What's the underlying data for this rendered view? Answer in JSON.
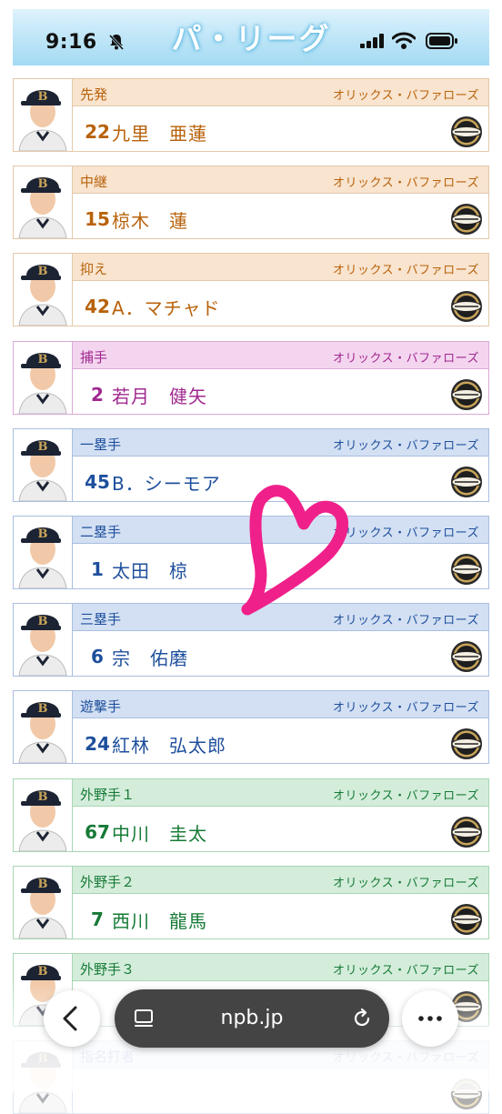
{
  "status_bar": {
    "time": "9:16"
  },
  "header": {
    "title": "パ・リーグ"
  },
  "players": [
    {
      "position": "先発",
      "team": "オリックス・バファローズ",
      "number": "22",
      "name": "九里　亜蓮",
      "theme": "orange"
    },
    {
      "position": "中継",
      "team": "オリックス・バファローズ",
      "number": "15",
      "name": "椋木　蓮",
      "theme": "orange"
    },
    {
      "position": "抑え",
      "team": "オリックス・バファローズ",
      "number": "42",
      "name": "A．マチャド",
      "theme": "orange"
    },
    {
      "position": "捕手",
      "team": "オリックス・バファローズ",
      "number": "2",
      "name": "若月　健矢",
      "theme": "pink"
    },
    {
      "position": "一塁手",
      "team": "オリックス・バファローズ",
      "number": "45",
      "name": "B．シーモア",
      "theme": "blue"
    },
    {
      "position": "二塁手",
      "team": "オリックス・バファローズ",
      "number": "1",
      "name": "太田　椋",
      "theme": "blue"
    },
    {
      "position": "三塁手",
      "team": "オリックス・バファローズ",
      "number": "6",
      "name": "宗　佑磨",
      "theme": "blue"
    },
    {
      "position": "遊撃手",
      "team": "オリックス・バファローズ",
      "number": "24",
      "name": "紅林　弘太郎",
      "theme": "blue"
    },
    {
      "position": "外野手１",
      "team": "オリックス・バファローズ",
      "number": "67",
      "name": "中川　圭太",
      "theme": "green"
    },
    {
      "position": "外野手２",
      "team": "オリックス・バファローズ",
      "number": "7",
      "name": "西川　龍馬",
      "theme": "green"
    },
    {
      "position": "外野手３",
      "team": "オリックス・バファローズ",
      "number": "",
      "name": "",
      "theme": "green"
    },
    {
      "position": "指名打者",
      "team": "オリックス・バファローズ",
      "number": "",
      "name": "",
      "theme": "blue"
    }
  ],
  "browser": {
    "url": "npb.jp"
  },
  "icons": {
    "back": "chevron-left-icon",
    "tabs": "tabs-icon",
    "reload": "reload-icon",
    "more": "more-icon",
    "logo": "buffaloes-logo"
  },
  "colors": {
    "orange": "#b8620b",
    "pink": "#a0288f",
    "blue": "#1e4f9c",
    "green": "#167a36",
    "heart": "#f0208a"
  }
}
